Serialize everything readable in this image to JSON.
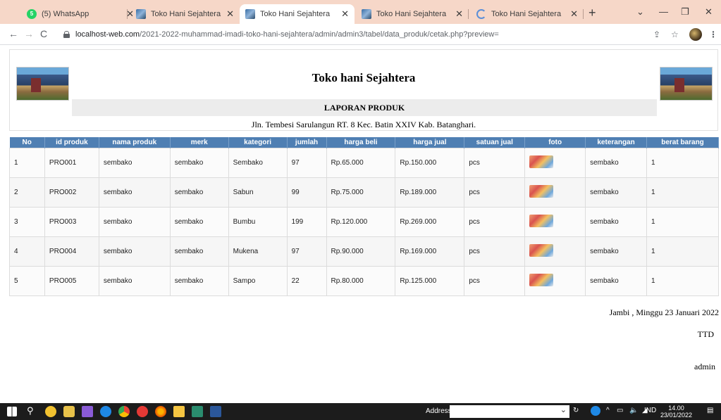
{
  "browser": {
    "tabs": [
      {
        "title": "(5) WhatsApp",
        "icon": "whatsapp-icon"
      },
      {
        "title": "Toko Hani Sejahtera",
        "icon": "store-favicon"
      },
      {
        "title": "Toko Hani Sejahtera",
        "icon": "store-favicon",
        "active": true
      },
      {
        "title": "Toko Hani Sejahtera",
        "icon": "store-favicon"
      },
      {
        "title": "Toko Hani Sejahtera",
        "icon": "loading-icon"
      }
    ],
    "url_host": "localhost-web.com",
    "url_path": "/2021-2022-muhammad-imadi-toko-hani-sejahtera/admin/admin3/tabel/data_produk/cetak.php?preview="
  },
  "report": {
    "store_name": "Toko hani Sejahtera",
    "title": "LAPORAN PRODUK",
    "address": "Jln. Tembesi Sarulangun RT. 8 Kec. Batin XXIV Kab. Batanghari.",
    "columns": [
      "No",
      "id produk",
      "nama produk",
      "merk",
      "kategori",
      "jumlah",
      "harga beli",
      "harga jual",
      "satuan jual",
      "foto",
      "keterangan",
      "berat barang"
    ],
    "rows": [
      {
        "no": "1",
        "id": "PRO001",
        "nama": "sembako",
        "merk": "sembako",
        "kategori": "Sembako",
        "jumlah": "97",
        "beli": "Rp.65.000",
        "jual": "Rp.150.000",
        "satuan": "pcs",
        "ket": "sembako",
        "berat": "1"
      },
      {
        "no": "2",
        "id": "PRO002",
        "nama": "sembako",
        "merk": "sembako",
        "kategori": "Sabun",
        "jumlah": "99",
        "beli": "Rp.75.000",
        "jual": "Rp.189.000",
        "satuan": "pcs",
        "ket": "sembako",
        "berat": "1"
      },
      {
        "no": "3",
        "id": "PRO003",
        "nama": "sembako",
        "merk": "sembako",
        "kategori": "Bumbu",
        "jumlah": "199",
        "beli": "Rp.120.000",
        "jual": "Rp.269.000",
        "satuan": "pcs",
        "ket": "sembako",
        "berat": "1"
      },
      {
        "no": "4",
        "id": "PRO004",
        "nama": "sembako",
        "merk": "sembako",
        "kategori": "Mukena",
        "jumlah": "97",
        "beli": "Rp.90.000",
        "jual": "Rp.169.000",
        "satuan": "pcs",
        "ket": "sembako",
        "berat": "1"
      },
      {
        "no": "5",
        "id": "PRO005",
        "nama": "sembako",
        "merk": "sembako",
        "kategori": "Sampo",
        "jumlah": "22",
        "beli": "Rp.80.000",
        "jual": "Rp.125.000",
        "satuan": "pcs",
        "ket": "sembako",
        "berat": "1"
      }
    ],
    "date_line": "Jambi , Minggu 23 Januari 2022",
    "signature_label": "TTD",
    "signer": "admin"
  },
  "taskbar": {
    "address_label": "Address",
    "language": "IND",
    "time": "14.00",
    "date": "23/01/2022"
  },
  "colors": {
    "tabstrip": "#f6d7c8",
    "table_header": "#4f7fb3",
    "taskbar": "#1c1c1c"
  }
}
